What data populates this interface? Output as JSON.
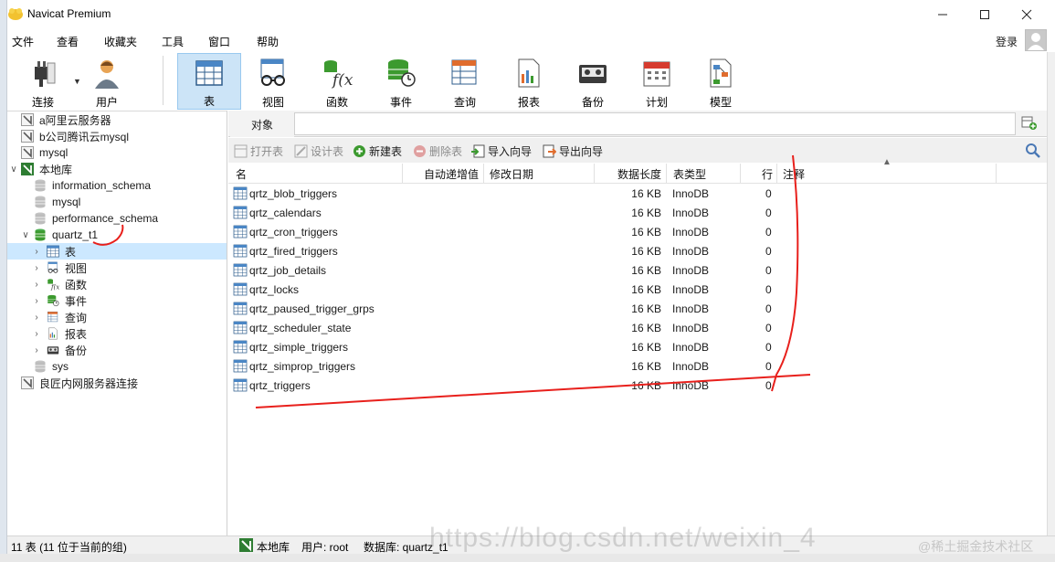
{
  "window": {
    "title": "Navicat Premium",
    "controls": [
      "minimize-icon",
      "maximize-icon",
      "close-icon"
    ]
  },
  "menu": {
    "items": [
      "文件",
      "查看",
      "收藏夹",
      "工具",
      "窗口",
      "帮助"
    ],
    "login": "登录"
  },
  "toolbar": {
    "items": [
      {
        "label": "连接",
        "icon": "plug-icon"
      },
      {
        "label": "用户",
        "icon": "user-icon"
      },
      {
        "label": "表",
        "icon": "table-icon",
        "active": true
      },
      {
        "label": "视图",
        "icon": "glasses-icon"
      },
      {
        "label": "函数",
        "icon": "function-icon"
      },
      {
        "label": "事件",
        "icon": "event-clock-icon"
      },
      {
        "label": "查询",
        "icon": "query-icon"
      },
      {
        "label": "报表",
        "icon": "report-icon"
      },
      {
        "label": "备份",
        "icon": "backup-tape-icon"
      },
      {
        "label": "计划",
        "icon": "calendar-icon"
      },
      {
        "label": "模型",
        "icon": "model-icon"
      }
    ]
  },
  "nav": {
    "items": [
      {
        "label": "a阿里云服务器",
        "icon": "connection-icon",
        "level": 0,
        "chevron": ""
      },
      {
        "label": "b公司腾讯云mysql",
        "icon": "connection-icon",
        "level": 0,
        "chevron": ""
      },
      {
        "label": "mysql",
        "icon": "connection-icon",
        "level": 0,
        "chevron": ""
      },
      {
        "label": "本地库",
        "icon": "connection-open-icon",
        "level": 0,
        "chevron": "∨"
      },
      {
        "label": "information_schema",
        "icon": "database-icon",
        "level": 1,
        "chevron": ""
      },
      {
        "label": "mysql",
        "icon": "database-icon",
        "level": 1,
        "chevron": ""
      },
      {
        "label": "performance_schema",
        "icon": "database-icon",
        "level": 1,
        "chevron": ""
      },
      {
        "label": "quartz_t1",
        "icon": "database-open-icon",
        "level": 1,
        "chevron": "∨"
      },
      {
        "label": "表",
        "icon": "table-icon",
        "level": 2,
        "chevron": "›",
        "selected": true
      },
      {
        "label": "视图",
        "icon": "glasses-icon",
        "level": 2,
        "chevron": "›"
      },
      {
        "label": "函数",
        "icon": "function-icon",
        "level": 2,
        "chevron": "›"
      },
      {
        "label": "事件",
        "icon": "event-clock-icon",
        "level": 2,
        "chevron": "›"
      },
      {
        "label": "查询",
        "icon": "query-icon",
        "level": 2,
        "chevron": "›"
      },
      {
        "label": "报表",
        "icon": "report-icon",
        "level": 2,
        "chevron": "›"
      },
      {
        "label": "备份",
        "icon": "backup-tape-icon",
        "level": 2,
        "chevron": "›"
      },
      {
        "label": "sys",
        "icon": "database-icon",
        "level": 1,
        "chevron": ""
      },
      {
        "label": "良匠内网服务器连接",
        "icon": "connection-icon",
        "level": 0,
        "chevron": ""
      }
    ]
  },
  "objects": {
    "tab": "对象",
    "buttons": [
      {
        "label": "打开表",
        "icon": "open-table-icon",
        "disabled": true
      },
      {
        "label": "设计表",
        "icon": "design-table-icon",
        "disabled": true
      },
      {
        "label": "新建表",
        "icon": "new-table-icon",
        "disabled": false
      },
      {
        "label": "删除表",
        "icon": "delete-table-icon",
        "disabled": true
      },
      {
        "label": "导入向导",
        "icon": "import-wizard-icon",
        "disabled": false
      },
      {
        "label": "导出向导",
        "icon": "export-wizard-icon",
        "disabled": false
      }
    ],
    "columns": [
      "名",
      "自动递增值",
      "修改日期",
      "数据长度",
      "表类型",
      "行",
      "注释"
    ],
    "rows": [
      {
        "name": "qrtz_blob_triggers",
        "size": "16 KB",
        "engine": "InnoDB",
        "rows": "0"
      },
      {
        "name": "qrtz_calendars",
        "size": "16 KB",
        "engine": "InnoDB",
        "rows": "0"
      },
      {
        "name": "qrtz_cron_triggers",
        "size": "16 KB",
        "engine": "InnoDB",
        "rows": "0"
      },
      {
        "name": "qrtz_fired_triggers",
        "size": "16 KB",
        "engine": "InnoDB",
        "rows": "0"
      },
      {
        "name": "qrtz_job_details",
        "size": "16 KB",
        "engine": "InnoDB",
        "rows": "0"
      },
      {
        "name": "qrtz_locks",
        "size": "16 KB",
        "engine": "InnoDB",
        "rows": "0"
      },
      {
        "name": "qrtz_paused_trigger_grps",
        "size": "16 KB",
        "engine": "InnoDB",
        "rows": "0"
      },
      {
        "name": "qrtz_scheduler_state",
        "size": "16 KB",
        "engine": "InnoDB",
        "rows": "0"
      },
      {
        "name": "qrtz_simple_triggers",
        "size": "16 KB",
        "engine": "InnoDB",
        "rows": "0"
      },
      {
        "name": "qrtz_simprop_triggers",
        "size": "16 KB",
        "engine": "InnoDB",
        "rows": "0"
      },
      {
        "name": "qrtz_triggers",
        "size": "16 KB",
        "engine": "InnoDB",
        "rows": "0"
      }
    ]
  },
  "status": {
    "count": "11 表 (11 位于当前的组)",
    "connection": "本地库",
    "user": "用户: root",
    "database": "数据库: quartz_t1"
  },
  "watermark": {
    "url": "https://blog.csdn.net/weixin_4",
    "credit": "@稀土掘金技术社区"
  },
  "colors": {
    "accent": "#cce4f7",
    "selection": "#cce8ff",
    "annotation": "#e8201c",
    "db_green": "#3c9a2f"
  }
}
